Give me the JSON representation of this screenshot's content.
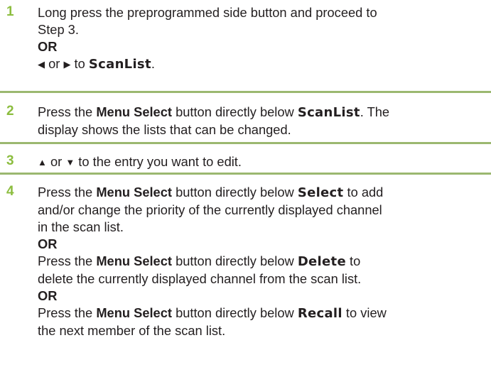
{
  "steps": [
    {
      "number": "1",
      "line1": "Long press the preprogrammed side button and proceed to",
      "line2": "Step 3.",
      "or": "OR",
      "nav_left_icon": "triangle-left",
      "nav_or": "or",
      "nav_right_icon": "triangle-right",
      "nav_to": "to",
      "nav_target": "ScanList",
      "nav_end": "."
    },
    {
      "number": "2",
      "a": "Press the ",
      "menu_select": "Menu Select",
      "b": " button directly below ",
      "disp": "ScanList",
      "c": ". The",
      "line2": "display shows the lists that can be changed."
    },
    {
      "number": "3",
      "up_icon": "triangle-up",
      "or": "or",
      "down_icon": "triangle-down",
      "text": "to the entry you want to edit."
    },
    {
      "number": "4",
      "p1": {
        "a": "Press the ",
        "menu_select": "Menu Select",
        "b": " button directly below ",
        "disp": "Select",
        "c": " to add",
        "line2": "and/or change the priority of the currently displayed channel",
        "line3": "in the scan list."
      },
      "or1": "OR",
      "p2": {
        "a": "Press the ",
        "menu_select": "Menu Select",
        "b": " button directly below ",
        "disp": "Delete",
        "c": " to",
        "line2": "delete the currently displayed channel from the scan list."
      },
      "or2": "OR",
      "p3": {
        "a": "Press the ",
        "menu_select": "Menu Select",
        "b": " button directly below ",
        "disp": "Recall",
        "c": " to view",
        "line2": "the next member of the scan list."
      }
    }
  ],
  "colors": {
    "step_number": "#8cbd3f",
    "rule": "#9bb870",
    "text": "#231f20"
  }
}
